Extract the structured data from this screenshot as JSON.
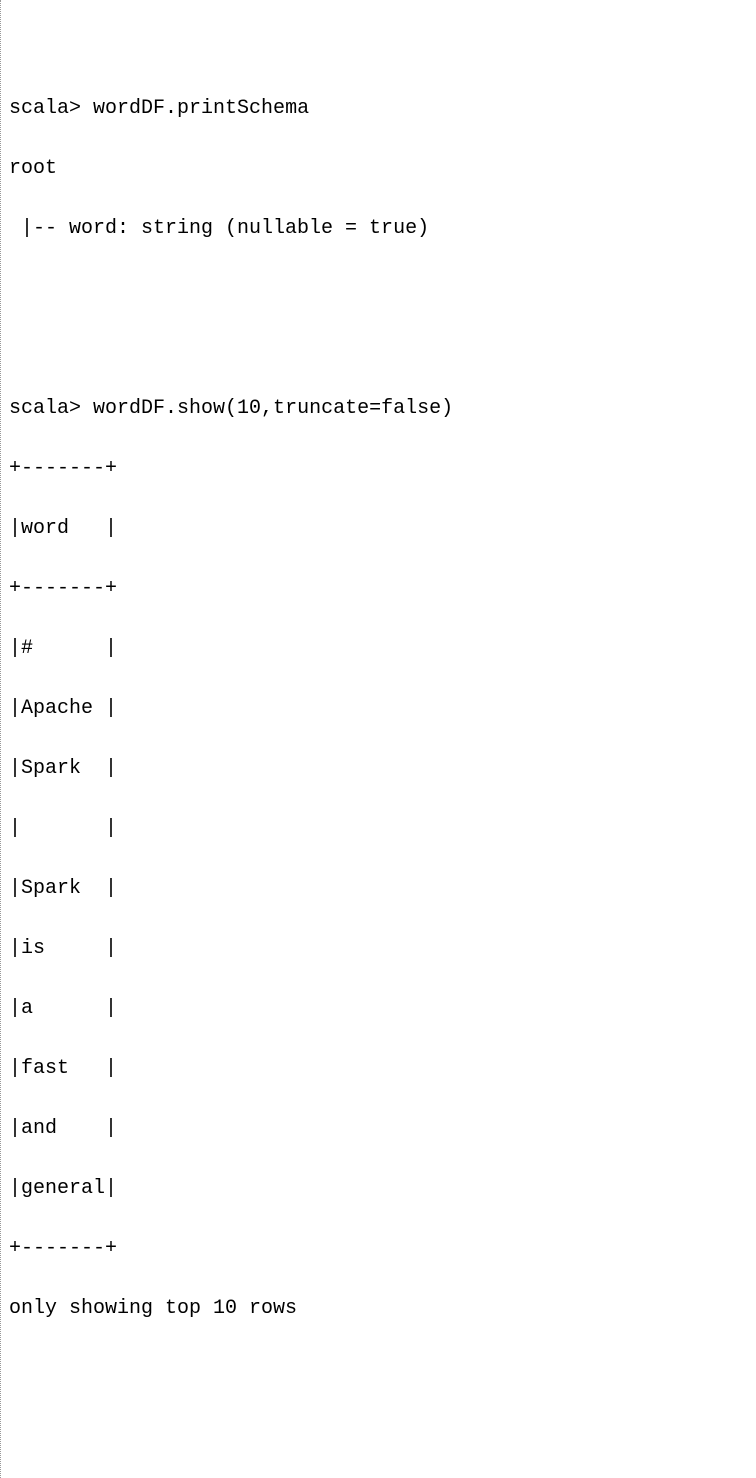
{
  "repl": {
    "prompt": "scala>",
    "cmd1": "wordDF.printSchema",
    "cmd2": "wordDF.show(10,truncate=false)"
  },
  "schema": {
    "root_label": "root",
    "field_line": " |-- word: string (nullable = true)"
  },
  "table": {
    "border": "+-------+",
    "header": "|word   |",
    "rows": [
      "|#      |",
      "|Apache |",
      "|Spark  |",
      "|       |",
      "|Spark  |",
      "|is     |",
      "|a      |",
      "|fast   |",
      "|and    |",
      "|general|"
    ],
    "footer_msg": "only showing top 10 rows"
  }
}
